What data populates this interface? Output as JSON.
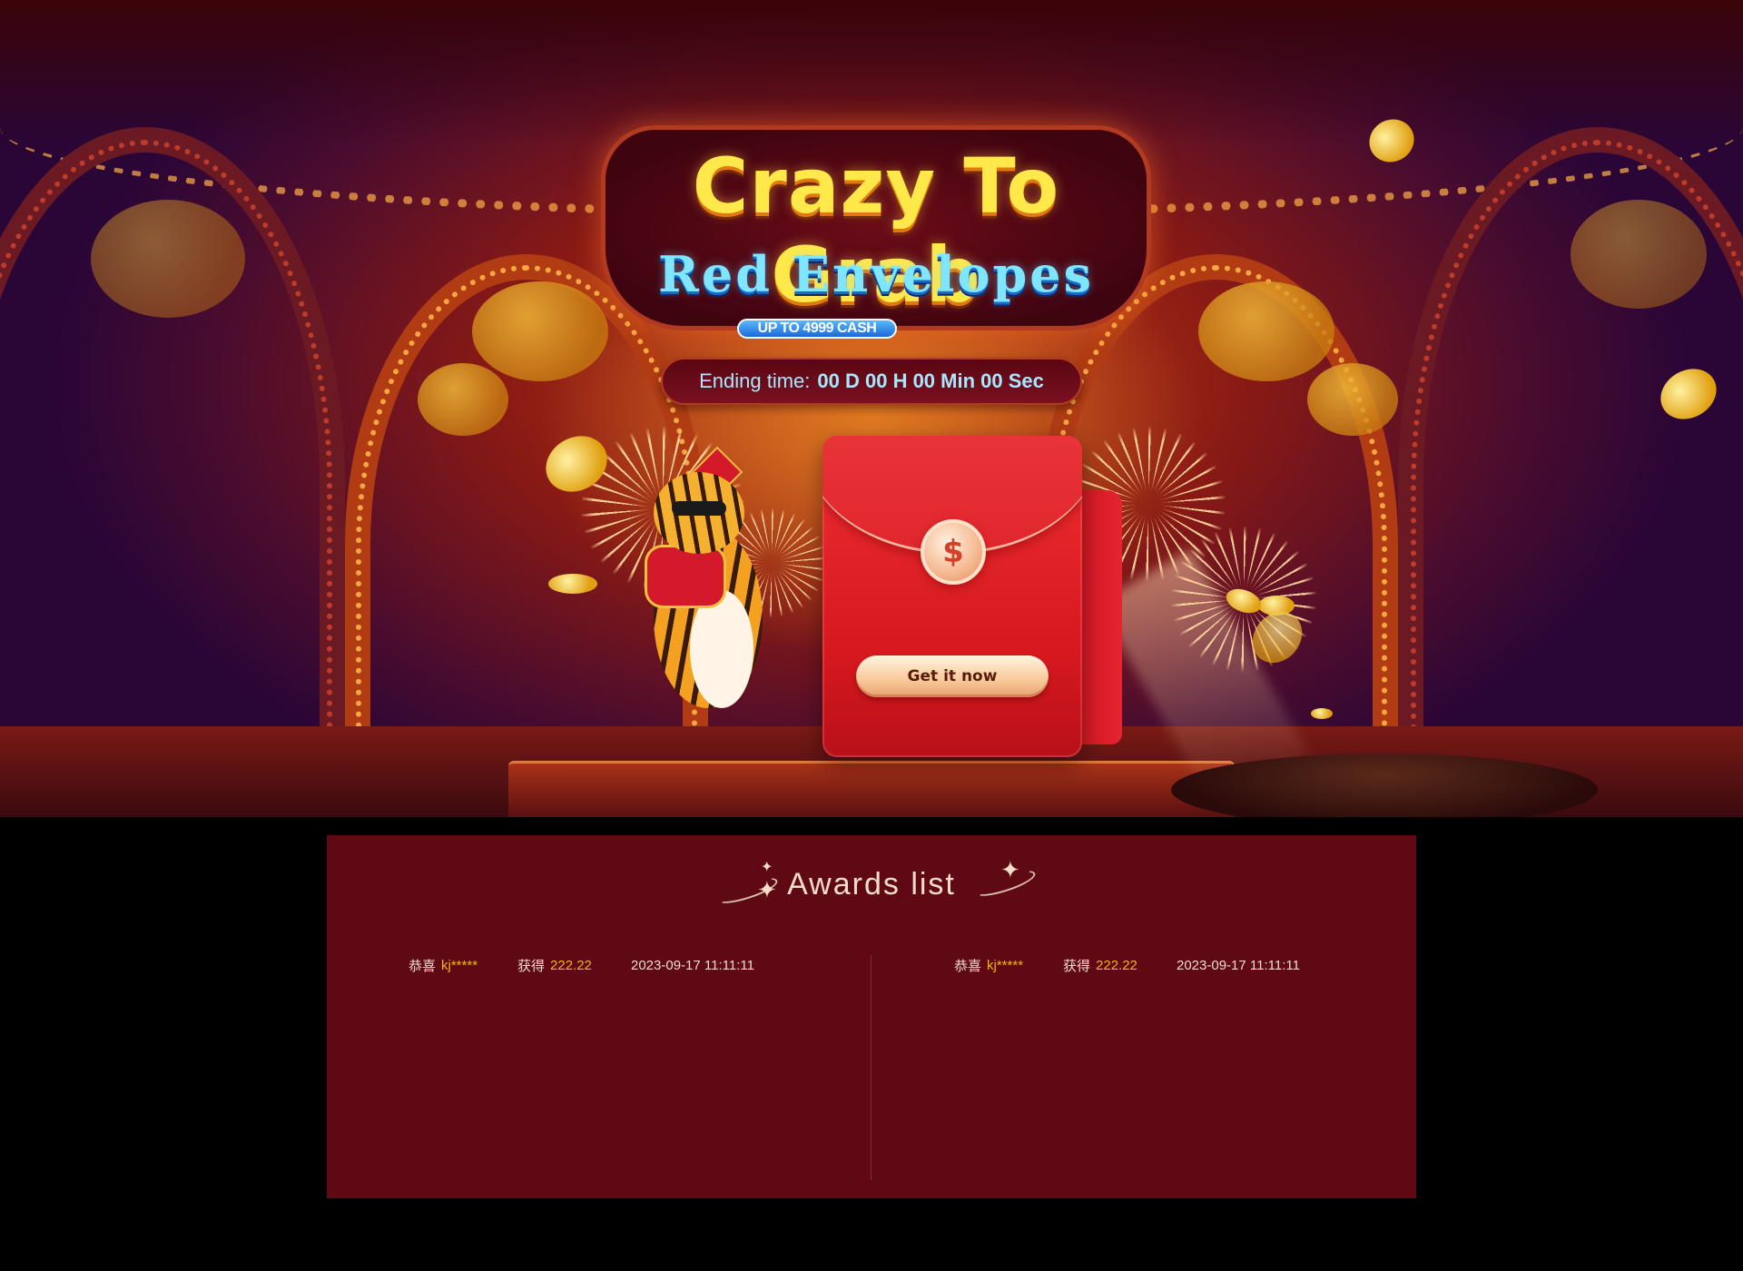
{
  "hero": {
    "title_line1": "Crazy To Grab",
    "title_line2": "Red Envelopes",
    "badge": "UP TO 4999 CASH",
    "countdown": {
      "label": "Ending time:",
      "value": "00 D 00 H 00 Min 00 Sec"
    },
    "envelope": {
      "seal_symbol": "$",
      "button_label": "Get it now"
    }
  },
  "awards": {
    "title": "Awards list",
    "entries": [
      {
        "prefix": "恭喜",
        "user": "kj*****",
        "verb": "获得",
        "amount": "222.22",
        "time": "2023-09-17 11:11:11"
      },
      {
        "prefix": "恭喜",
        "user": "kj*****",
        "verb": "获得",
        "amount": "222.22",
        "time": "2023-09-17 11:11:11"
      }
    ]
  },
  "colors": {
    "page_bg": "#000000",
    "panel_bg": "#5e0914",
    "title_yellow": "#ffe94a",
    "subtitle_cyan": "#7ee6ff",
    "highlight_gold": "#f6b312",
    "envelope_red": "#e52430"
  }
}
